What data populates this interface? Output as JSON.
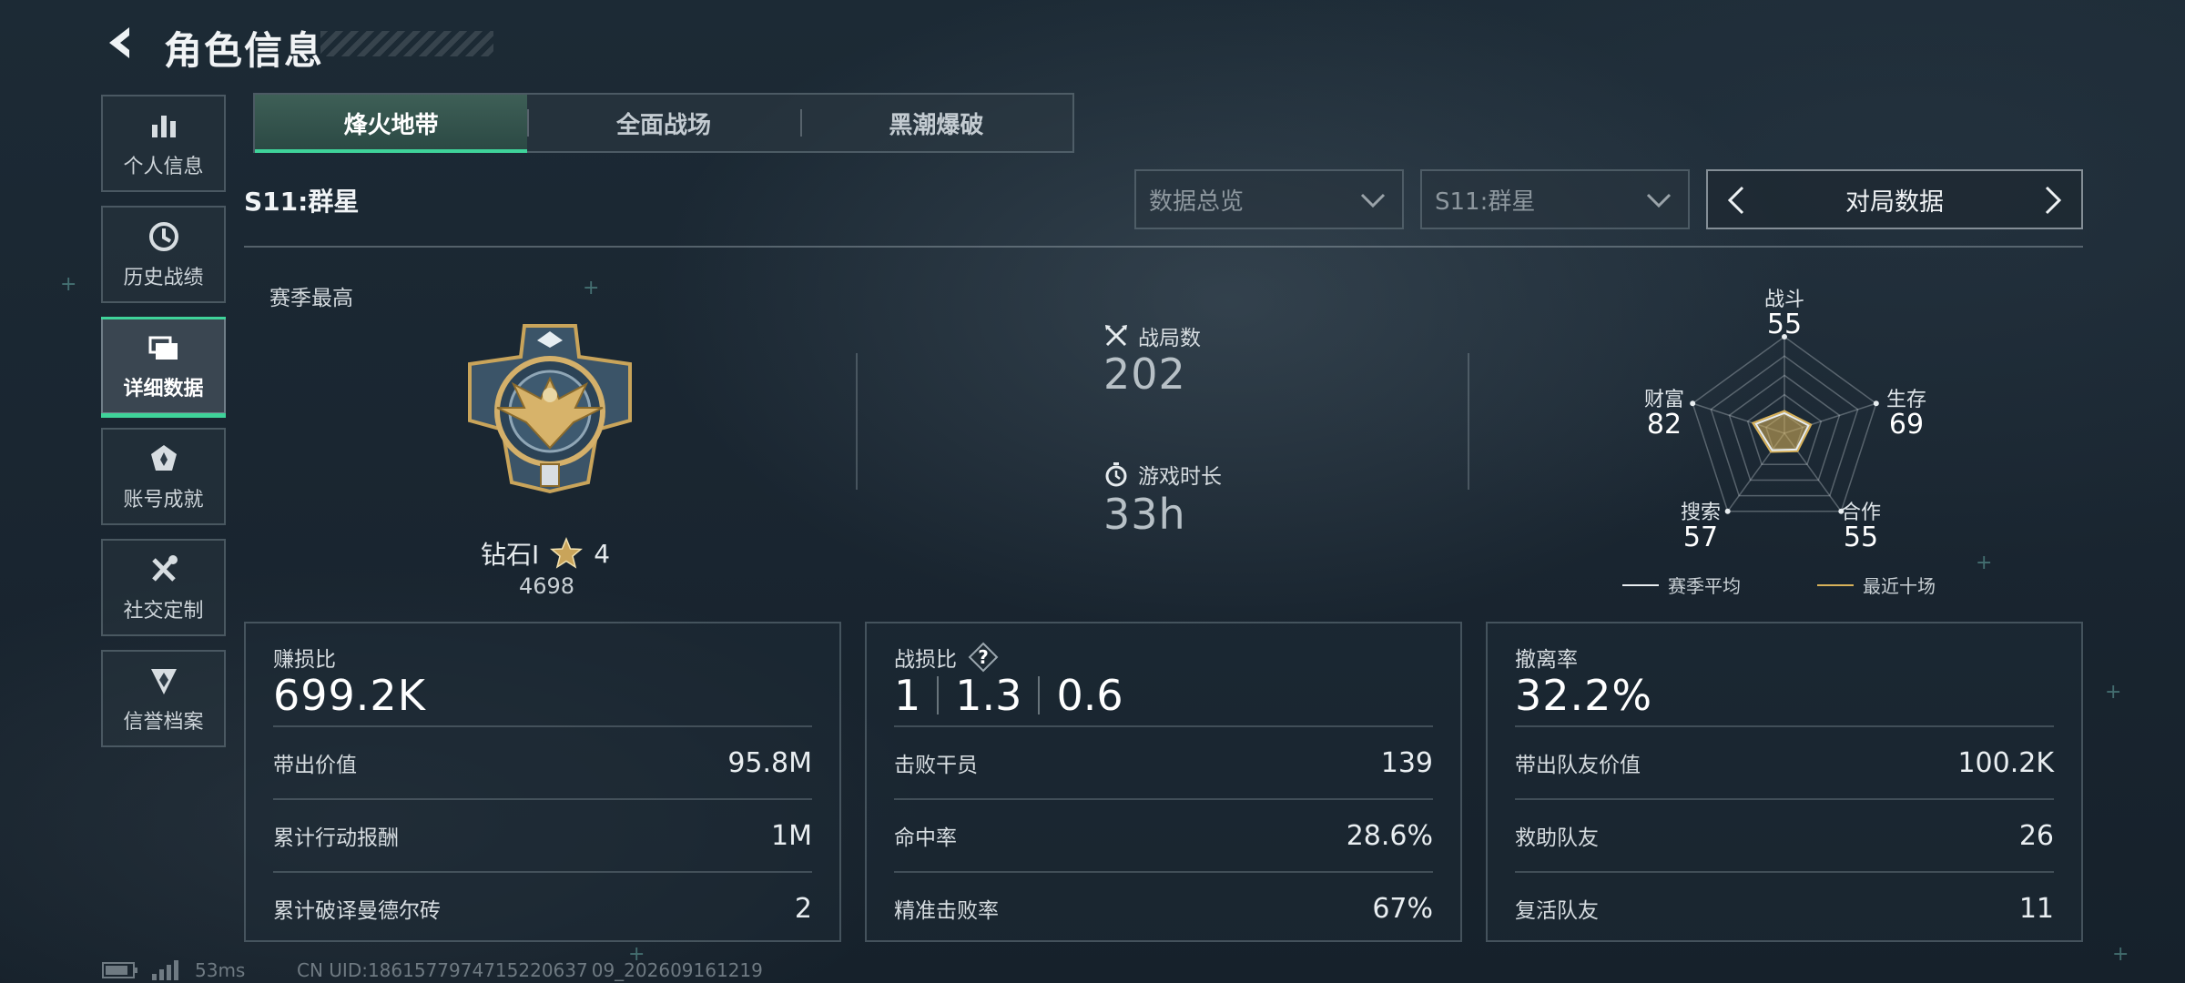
{
  "header": {
    "title": "角色信息",
    "back_icon": "back-arrow-icon"
  },
  "nav": {
    "items": [
      {
        "label": "个人信息",
        "icon": "bar-chart-icon",
        "active": false
      },
      {
        "label": "历史战绩",
        "icon": "clock-icon",
        "active": false
      },
      {
        "label": "详细数据",
        "icon": "stacked-cards-icon",
        "active": true
      },
      {
        "label": "账号成就",
        "icon": "achievement-icon",
        "active": false
      },
      {
        "label": "社交定制",
        "icon": "tools-icon",
        "active": false
      },
      {
        "label": "信誉档案",
        "icon": "shield-emblem-icon",
        "active": false
      }
    ]
  },
  "tabs": [
    {
      "label": "烽火地带",
      "active": true
    },
    {
      "label": "全面战场",
      "active": false
    },
    {
      "label": "黑潮爆破",
      "active": false
    }
  ],
  "season": {
    "label": "S11:群星"
  },
  "filters": {
    "view_select": "数据总览",
    "season_select": "S11:群星",
    "mode_switch": "对局数据"
  },
  "season_best": {
    "label": "赛季最高",
    "rank": "钻石I",
    "stars": "4",
    "score": "4698"
  },
  "counts": {
    "matches_label": "战局数",
    "matches_value": "202",
    "playtime_label": "游戏时长",
    "playtime_value": "33h"
  },
  "radar": {
    "axes": [
      {
        "name": "战斗",
        "value": "55"
      },
      {
        "name": "生存",
        "value": "69"
      },
      {
        "name": "合作",
        "value": "55"
      },
      {
        "name": "搜索",
        "value": "57"
      },
      {
        "name": "财富",
        "value": "82"
      }
    ],
    "legend": {
      "season_avg": "赛季平均",
      "recent_ten": "最近十场"
    },
    "colors": {
      "season_avg": "#e8edf0",
      "recent_ten": "#d8b25a"
    }
  },
  "panels": {
    "profit": {
      "title": "赚损比",
      "value": "699.2K",
      "rows": [
        {
          "label": "带出价值",
          "value": "95.8M"
        },
        {
          "label": "累计行动报酬",
          "value": "1M"
        },
        {
          "label": "累计破译曼德尔砖",
          "value": "2"
        }
      ]
    },
    "kd": {
      "title": "战损比",
      "help": "?",
      "values": [
        "1",
        "1.3",
        "0.6"
      ],
      "rows": [
        {
          "label": "击败干员",
          "value": "139"
        },
        {
          "label": "命中率",
          "value": "28.6%"
        },
        {
          "label": "精准击败率",
          "value": "67%"
        }
      ]
    },
    "extract": {
      "title": "撤离率",
      "value": "32.2%",
      "rows": [
        {
          "label": "带出队友价值",
          "value": "100.2K"
        },
        {
          "label": "救助队友",
          "value": "26"
        },
        {
          "label": "复活队友",
          "value": "11"
        }
      ]
    }
  },
  "footer": {
    "ping": "53ms",
    "uid": "CN UID:1861577974715220637 09_202609161219"
  },
  "accent": "#3fd39a"
}
